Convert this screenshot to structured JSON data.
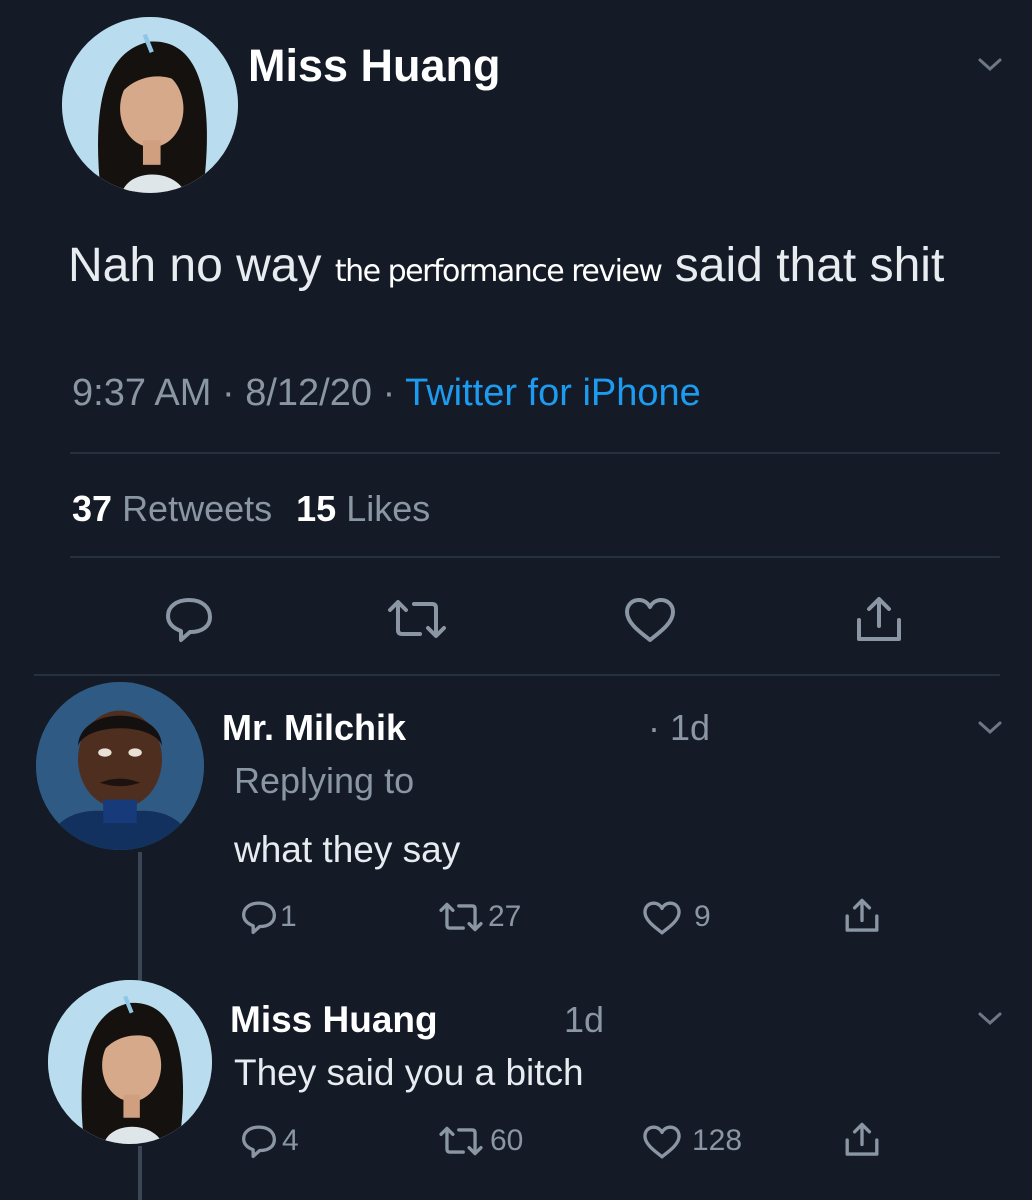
{
  "main_tweet": {
    "author": "Miss Huang",
    "text_before": "Nah no way ",
    "text_overlay": "the performance review",
    "text_after": " said that shit",
    "time": "9:37 AM",
    "date": "8/12/20",
    "source": "Twitter for iPhone",
    "sep": "·",
    "retweets_count": "37",
    "retweets_label": "Retweets",
    "likes_count": "15",
    "likes_label": "Likes"
  },
  "reply1": {
    "author": "Mr. Milchik",
    "time": "· 1d",
    "replying_to": "Replying to",
    "text": "what they say",
    "replies": "1",
    "retweets": "27",
    "likes": "9"
  },
  "reply2": {
    "author": "Miss Huang",
    "time": "1d",
    "text": "They said you a bitch",
    "replies": "4",
    "retweets": "60",
    "likes": "128"
  },
  "colors": {
    "background": "#141b26",
    "accent": "#1d9bf0",
    "muted": "#8a96a3"
  },
  "icons": [
    "chevron-down-icon",
    "reply-icon",
    "retweet-icon",
    "like-icon",
    "share-icon"
  ]
}
